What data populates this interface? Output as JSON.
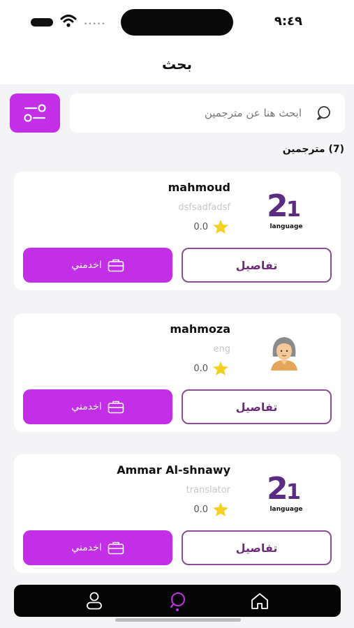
{
  "status_bar": {
    "time": "٩:٤٩",
    "signal": "•••••"
  },
  "header": {
    "title": "بحث"
  },
  "search": {
    "placeholder": "ابحث هنا عن مترجمين",
    "value": ""
  },
  "results": {
    "count_label": "(7) مترجمين"
  },
  "translators": [
    {
      "name": "mahmoud",
      "subtitle": "dsfsadfadsf",
      "rating": "0.0",
      "image": "language-logo-icon",
      "logo_text": "language",
      "details_label": "تفاصيل",
      "serve_label": "اخدمني"
    },
    {
      "name": "mahmoza",
      "subtitle": "eng",
      "rating": "0.0",
      "image": "woman-avatar",
      "details_label": "تفاصيل",
      "serve_label": "اخدمني"
    },
    {
      "name": "Ammar Al-shnawy",
      "subtitle": "translator",
      "rating": "0.0",
      "image": "language-logo-icon",
      "logo_text": "language",
      "details_label": "تفاصيل",
      "serve_label": "اخدمني"
    }
  ],
  "bottom_nav": [
    {
      "icon": "person-icon",
      "active": false
    },
    {
      "icon": "search-icon",
      "active": true
    },
    {
      "icon": "home-icon",
      "active": false
    }
  ],
  "colors": {
    "accent": "#c22fe6",
    "details_text": "#6f2a7c",
    "details_border": "#8a4d95",
    "star": "#f5d020",
    "logo": "#5a2d82"
  }
}
